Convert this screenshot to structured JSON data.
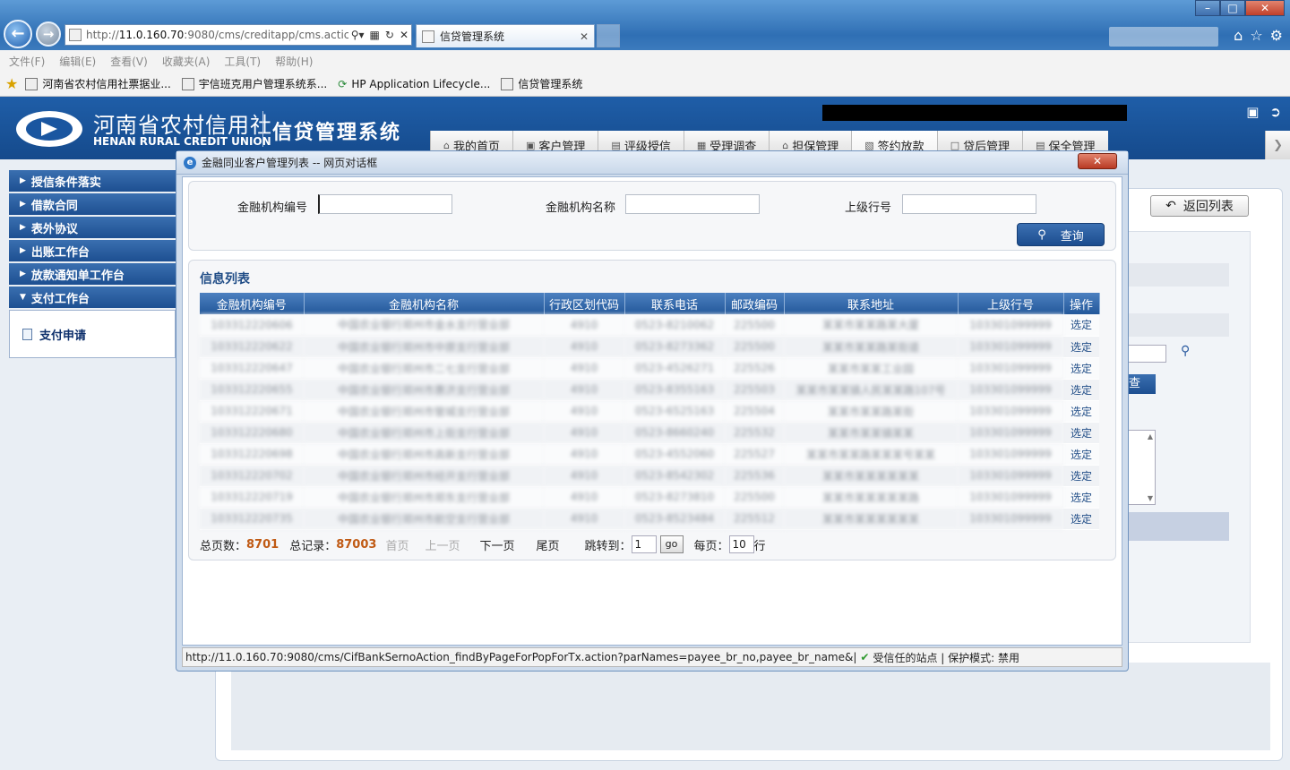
{
  "browser": {
    "url": "http://11.0.160.70:9080/cms/creditapp/cms.actic",
    "url_host": "11.0.160.70",
    "url_prefix": "http://",
    "url_suffix": ":9080/cms/creditapp/cms.actic",
    "tab_title": "信贷管理系统",
    "menu": [
      "文件(F)",
      "编辑(E)",
      "查看(V)",
      "收藏夹(A)",
      "工具(T)",
      "帮助(H)"
    ],
    "favorites": [
      "河南省农村信用社票据业...",
      "宇信班克用户管理系统系...",
      "HP Application Lifecycle...",
      "信贷管理系统"
    ]
  },
  "app": {
    "org_cn": "河南省农村信用社",
    "org_en": "HENAN RURAL CREDIT UNION",
    "system_title": "信贷管理系统",
    "nav": [
      "我的首页",
      "客户管理",
      "评级授信",
      "受理调查",
      "担保管理",
      "签约放款",
      "贷后管理",
      "保全管理"
    ],
    "nav_active": "签约放款"
  },
  "sidebar": {
    "items": [
      "授信条件落实",
      "借款合同",
      "表外协议",
      "出账工作台",
      "放款通知单工作台",
      "支付工作台"
    ],
    "sub_item": "支付申请"
  },
  "main": {
    "return_label": "返回列表",
    "query_fragment": "查"
  },
  "dialog": {
    "title": "金融同业客户管理列表 -- 网页对话框",
    "filters": {
      "code_label": "金融机构编号",
      "name_label": "金融机构名称",
      "parent_label": "上级行号"
    },
    "query_label": "查询",
    "list_title": "信息列表",
    "columns": [
      "金融机构编号",
      "金融机构名称",
      "行政区划代码",
      "联系电话",
      "邮政编码",
      "联系地址",
      "上级行号",
      "操作"
    ],
    "rows": [
      [
        "103312220606",
        "中国农业银行郑州市金水支行营业部",
        "4910",
        "0523-8210062",
        "225500",
        "某某市某某路某大厦",
        "103301099999",
        "选定"
      ],
      [
        "103312220622",
        "中国农业银行郑州市中原支行营业部",
        "4910",
        "0523-8273362",
        "225500",
        "某某市某某路某街道",
        "103301099999",
        "选定"
      ],
      [
        "103312220647",
        "中国农业银行郑州市二七支行营业部",
        "4910",
        "0523-4526271",
        "225526",
        "某某市某某工业园",
        "103301099999",
        "选定"
      ],
      [
        "103312220655",
        "中国农业银行郑州市惠济支行营业部",
        "4910",
        "0523-8355163",
        "225503",
        "某某市某某镇人民某某路107号",
        "103301099999",
        "选定"
      ],
      [
        "103312220671",
        "中国农业银行郑州市管城支行营业部",
        "4910",
        "0523-6525163",
        "225504",
        "某某市某某路某街",
        "103301099999",
        "选定"
      ],
      [
        "103312220680",
        "中国农业银行郑州市上街支行营业部",
        "4910",
        "0523-8660240",
        "225532",
        "某某市某某镇某某",
        "103301099999",
        "选定"
      ],
      [
        "103312220698",
        "中国农业银行郑州市高新支行营业部",
        "4910",
        "0523-4552060",
        "225527",
        "某某市某某路某某某号某某",
        "103301099999",
        "选定"
      ],
      [
        "103312220702",
        "中国农业银行郑州市经开支行营业部",
        "4910",
        "0523-8542302",
        "225536",
        "某某市某某某某某某",
        "103301099999",
        "选定"
      ],
      [
        "103312220719",
        "中国农业银行郑州市郑东支行营业部",
        "4910",
        "0523-8273810",
        "225500",
        "某某市某某某某某路",
        "103301099999",
        "选定"
      ],
      [
        "103312220735",
        "中国农业银行郑州市航空支行营业部",
        "4910",
        "0523-8523484",
        "225512",
        "某某市某某某某某某",
        "103301099999",
        "选定"
      ]
    ],
    "pager": {
      "total_pages_label": "总页数：",
      "total_pages": "8701",
      "total_records_label": "总记录：",
      "total_records": "87003",
      "first": "首页",
      "prev": "上一页",
      "next": "下一页",
      "last": "尾页",
      "jump_label": "跳转到：",
      "jump_value": "1",
      "go": "go",
      "per_page_label": "每页：",
      "per_page": "10",
      "per_page_unit": "行"
    },
    "status_url": "http://11.0.160.70:9080/cms/CifBankSernoAction_findByPageForPopForTx.action?parNames=payee_br_no,payee_br_name&|",
    "status_trusted": "受信任的站点 | 保护模式: 禁用"
  }
}
